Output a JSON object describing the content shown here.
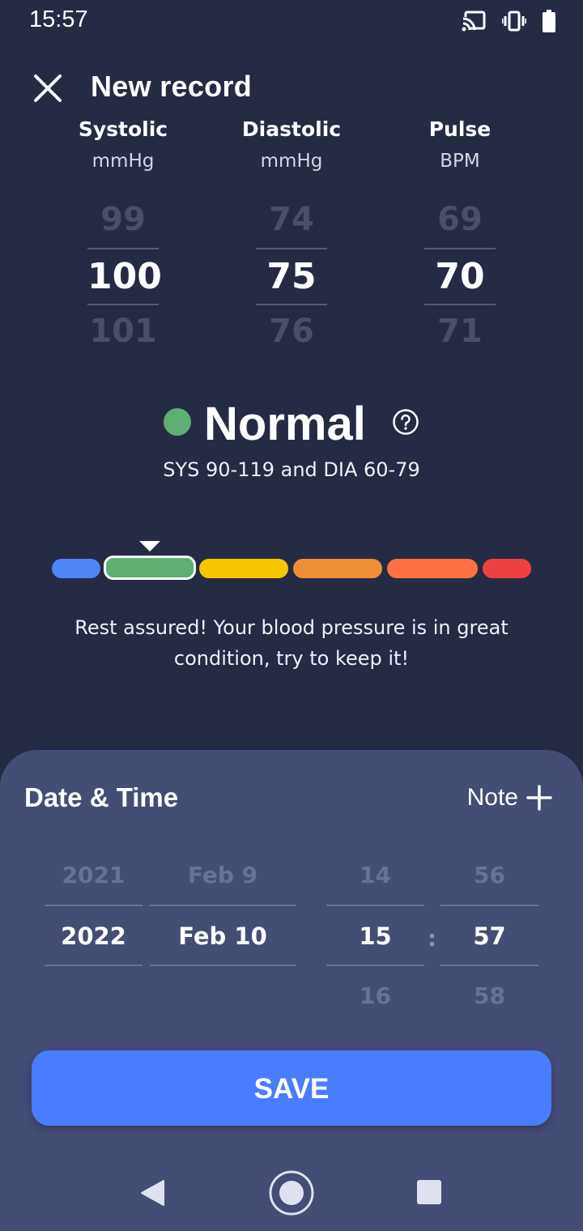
{
  "status_bar": {
    "time": "15:57",
    "icons": [
      "cast-icon",
      "vibrate-icon",
      "battery-icon"
    ]
  },
  "header": {
    "title": "New record",
    "close_icon": "close-icon"
  },
  "measurements": [
    {
      "title": "Systolic",
      "unit": "mmHg",
      "prev": "99",
      "value": "100",
      "next": "101"
    },
    {
      "title": "Diastolic",
      "unit": "mmHg",
      "prev": "74",
      "value": "75",
      "next": "76"
    },
    {
      "title": "Pulse",
      "unit": "BPM",
      "prev": "69",
      "value": "70",
      "next": "71"
    }
  ],
  "status": {
    "label": "Normal",
    "color": "#5fae74",
    "range": "SYS 90-119 and DIA 60-79",
    "help_icon": "help-circle-icon"
  },
  "scale": {
    "segments": [
      {
        "color": "#4f86f7"
      },
      {
        "color": "#5fae74",
        "active": true
      },
      {
        "color": "#f7c600"
      },
      {
        "color": "#ef8f35"
      },
      {
        "color": "#ff7043"
      },
      {
        "color": "#ef4141"
      }
    ]
  },
  "message": "Rest assured! Your blood pressure is in great condition, try to keep it!",
  "datetime": {
    "title": "Date & Time",
    "note_label": "Note",
    "year": {
      "prev": "2021",
      "value": "2022"
    },
    "date": {
      "prev": "Feb 9",
      "value": "Feb 10"
    },
    "hour": {
      "prev": "14",
      "value": "15",
      "next": "16"
    },
    "minute": {
      "prev": "56",
      "value": "57",
      "next": "58"
    },
    "separator": ":"
  },
  "save_label": "SAVE",
  "colors": {
    "background": "#262b44",
    "sheet": "#434d75",
    "accent": "#4a7cff"
  }
}
